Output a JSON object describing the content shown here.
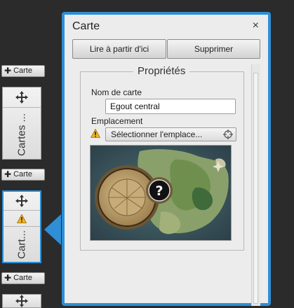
{
  "timeline": {
    "add_buttons": [
      "Carte",
      "Carte",
      "Carte"
    ],
    "cards": [
      {
        "label": "Cartes ..."
      },
      {
        "label": "Cart..."
      }
    ]
  },
  "dialog": {
    "title": "Carte",
    "close": "×",
    "read_from_here": "Lire à partir d'ici",
    "delete": "Supprimer",
    "properties_title": "Propriétés",
    "map_name_label": "Nom de carte",
    "map_name_value": "Egout central",
    "location_label": "Emplacement",
    "location_value": "Sélectionner l'emplace..."
  },
  "icons": {
    "move": "move-icon",
    "warning": "warning-icon",
    "close": "close-icon",
    "location": "crosshair-icon",
    "question": "question-icon"
  },
  "colors": {
    "accent": "#2e8fd6",
    "warning": "#f3b51f",
    "background": "#2b2b2b"
  }
}
